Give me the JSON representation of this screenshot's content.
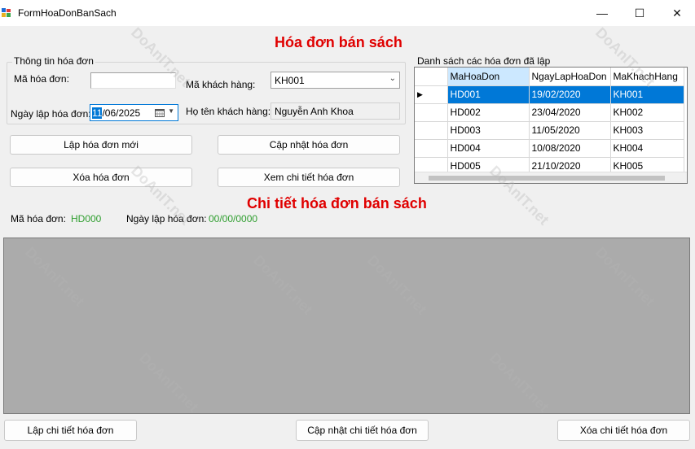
{
  "window": {
    "title": "FormHoaDonBanSach",
    "minimize_glyph": "—",
    "maximize_glyph": "☐",
    "close_glyph": "✕"
  },
  "header": {
    "main_title": "Hóa đơn bán sách",
    "detail_title": "Chi tiết hóa đơn bán sách"
  },
  "invoice_info": {
    "group_label": "Thông tin hóa đơn",
    "invoice_id_label": "Mã hóa đơn:",
    "invoice_id_value": "",
    "customer_id_label": "Mã khách hàng:",
    "customer_id_value": "KH001",
    "date_label": "Ngày lập hóa đơn:",
    "date_selected_part": "11",
    "date_rest": "/06/2025",
    "customer_name_label": "Họ tên khách hàng:",
    "customer_name_value": "Nguyễn Anh Khoa"
  },
  "buttons": {
    "new_invoice": "Lập hóa đơn mới",
    "update_invoice": "Cập nhật hóa đơn",
    "delete_invoice": "Xóa hóa đơn",
    "view_detail": "Xem chi tiết hóa đơn",
    "new_detail": "Lập chi tiết hóa đơn",
    "update_detail": "Cập nhật chi tiết hóa đơn",
    "delete_detail": "Xóa chi tiết hóa đơn"
  },
  "invoice_list": {
    "label": "Danh sách các hóa đơn đã lập",
    "columns": [
      "MaHoaDon",
      "NgayLapHoaDon",
      "MaKhachHang"
    ],
    "rows": [
      [
        "HD001",
        "19/02/2020",
        "KH001"
      ],
      [
        "HD002",
        "23/04/2020",
        "KH002"
      ],
      [
        "HD003",
        "11/05/2020",
        "KH003"
      ],
      [
        "HD004",
        "10/08/2020",
        "KH004"
      ],
      [
        "HD005",
        "21/10/2020",
        "KH005"
      ]
    ],
    "selected_row_marker": "▶"
  },
  "detail_info": {
    "invoice_id_label": "Mã hóa đơn:",
    "invoice_id_value": "HD000",
    "date_label": "Ngày lập hóa đơn:",
    "date_value": "00/00/0000"
  },
  "watermark": "DoAnIT.net",
  "colors": {
    "title_red": "#e00000",
    "value_green": "#2f9e2f",
    "selection_blue": "#0078d7",
    "detail_grid_bg": "#ababab"
  }
}
